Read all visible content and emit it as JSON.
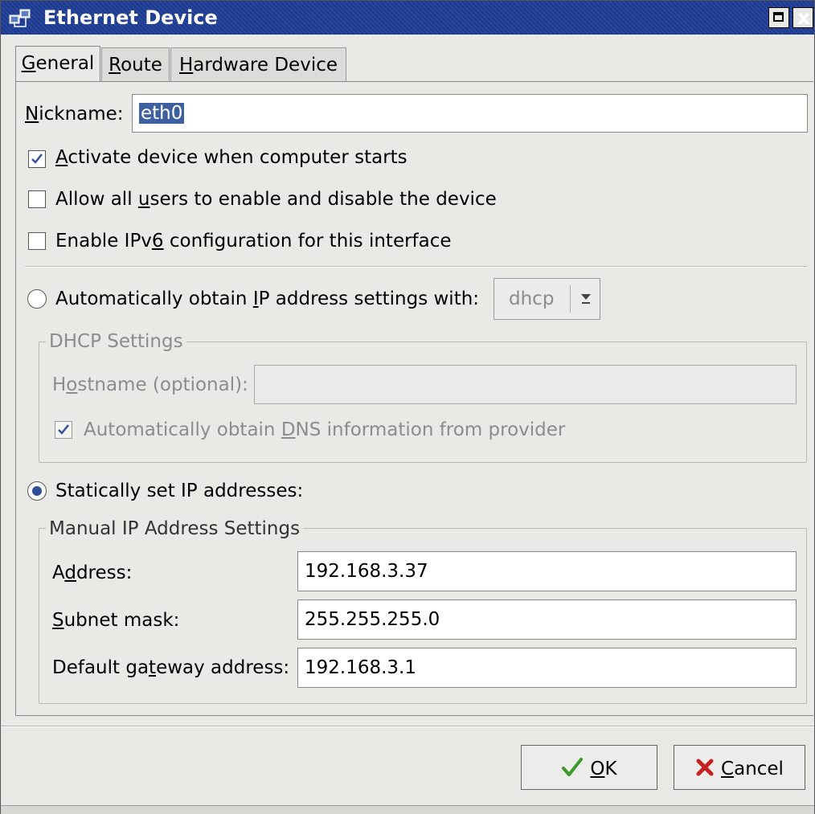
{
  "window": {
    "title": "Ethernet Device",
    "icon": "network-device-icon",
    "maximize_icon": "maximize-icon",
    "close_label": "x",
    "close_icon": "close-icon"
  },
  "tabs": [
    {
      "label": "General",
      "mnemonic": "G",
      "rest": "eneral",
      "active": true
    },
    {
      "label": "Route",
      "mnemonic": "R",
      "rest": "oute",
      "active": false
    },
    {
      "label": "Hardware Device",
      "mnemonic": "H",
      "rest": "ardware Device",
      "active": false
    }
  ],
  "nickname": {
    "label_mnemonic": "N",
    "label_rest": "ickname:",
    "value": "eth0"
  },
  "options": {
    "activate": {
      "pre": "",
      "mn": "A",
      "post": "ctivate device when computer starts",
      "checked": true
    },
    "allow_users": {
      "pre": "Allow all ",
      "mn": "u",
      "post": "sers to enable and disable the device",
      "checked": false
    },
    "ipv6": {
      "pre": "Enable IPv",
      "mn": "6",
      "post": " configuration for this interface",
      "checked": false
    }
  },
  "auto_ip": {
    "pre": "Automatically obtain ",
    "mn": "I",
    "post": "P address settings with:",
    "selected": false,
    "protocol": "dhcp"
  },
  "dhcp_settings": {
    "title": "DHCP Settings",
    "hostname_pre": "H",
    "hostname_mn": "o",
    "hostname_post": "stname (optional):",
    "hostname_value": "",
    "dns_pre": "Automatically obtain ",
    "dns_mn": "D",
    "dns_post": "NS information from provider",
    "dns_checked": true
  },
  "static_ip": {
    "label": "Statically set IP addresses:",
    "selected": true
  },
  "manual_settings": {
    "title": "Manual IP Address Settings",
    "address_pre": "A",
    "address_mn": "d",
    "address_post": "dress:",
    "address_value": "192.168.3.37",
    "subnet_pre": "",
    "subnet_mn": "S",
    "subnet_post": "ubnet mask:",
    "subnet_value": "255.255.255.0",
    "gateway_pre": "Default ga",
    "gateway_mn": "t",
    "gateway_post": "eway address:",
    "gateway_value": "192.168.3.1"
  },
  "buttons": {
    "ok_mn": "O",
    "ok_rest": "K",
    "ok_icon": "checkmark-icon",
    "cancel_mn": "C",
    "cancel_rest": "ancel",
    "cancel_icon": "red-x-icon"
  },
  "colors": {
    "titlebar": "#1c3a91",
    "selection": "#3e5fa0",
    "radio_dot": "#2f4f9a",
    "check": "#2f4f9a",
    "ok_check": "#3c9a2a",
    "cancel_x": "#c62020"
  }
}
